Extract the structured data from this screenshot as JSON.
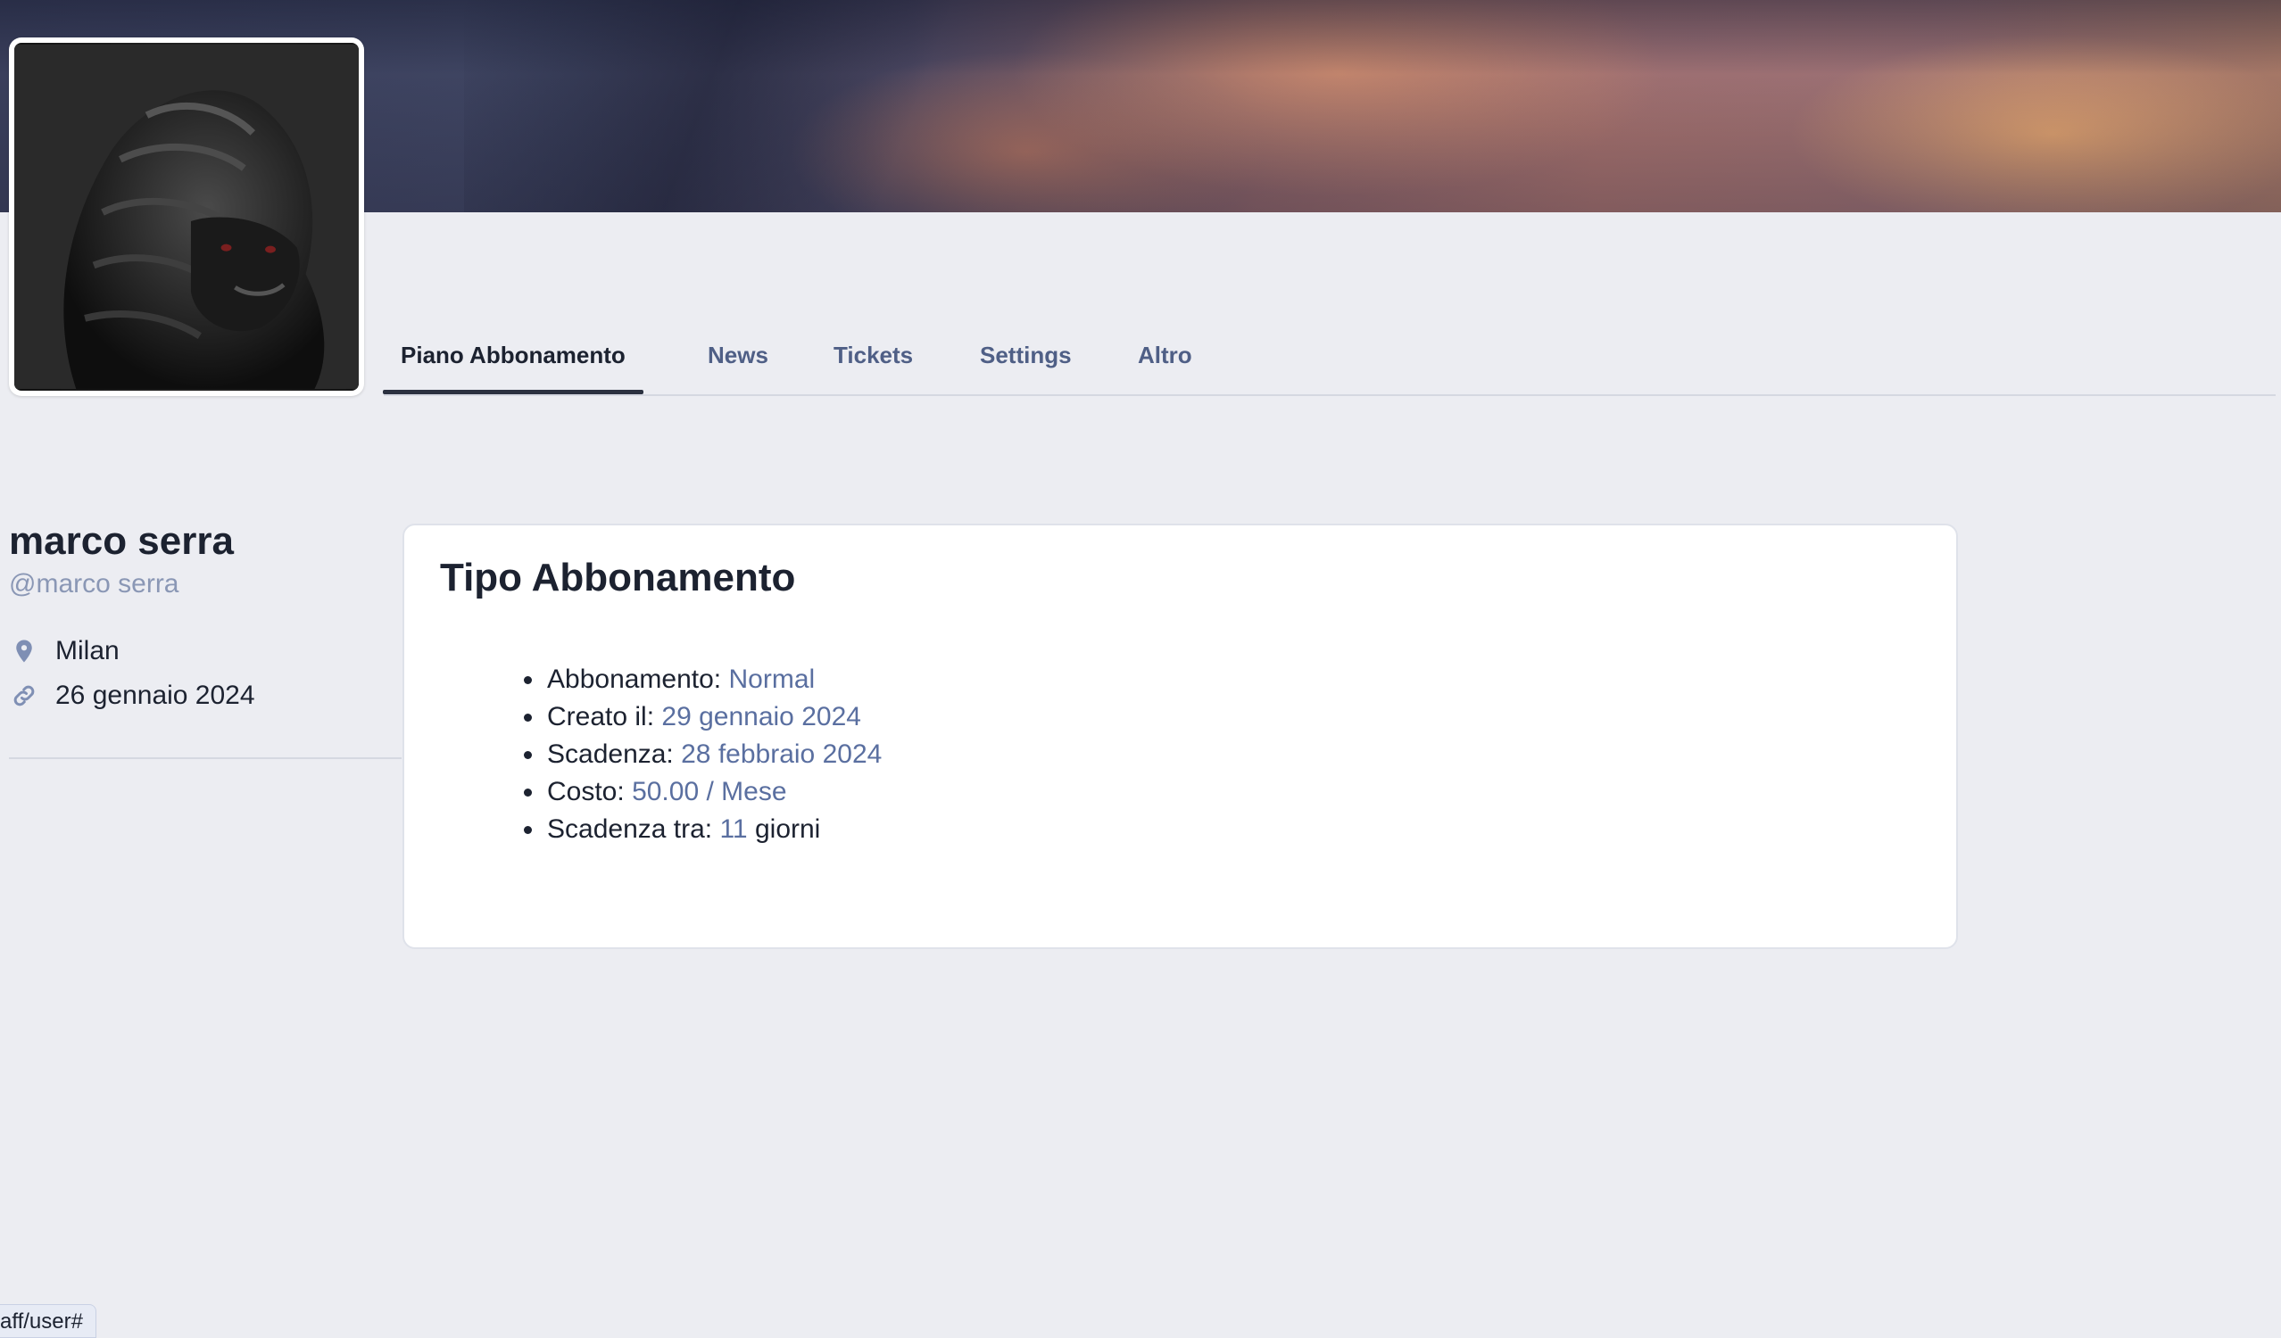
{
  "profile": {
    "name": "marco serra",
    "handle": "@marco serra",
    "location": "Milan",
    "joined": "26 gennaio 2024"
  },
  "tabs": [
    {
      "label": "Piano Abbonamento",
      "active": true
    },
    {
      "label": "News",
      "active": false
    },
    {
      "label": "Tickets",
      "active": false
    },
    {
      "label": "Settings",
      "active": false
    },
    {
      "label": "Altro",
      "active": false
    }
  ],
  "subscription": {
    "title": "Tipo Abbonamento",
    "items": [
      {
        "label": "Abbonamento:",
        "value": "Normal",
        "suffix": ""
      },
      {
        "label": "Creato il:",
        "value": "29 gennaio 2024",
        "suffix": ""
      },
      {
        "label": "Scadenza:",
        "value": "28 febbraio 2024",
        "suffix": ""
      },
      {
        "label": "Costo:",
        "value": "50.00 / Mese",
        "suffix": ""
      },
      {
        "label": "Scadenza tra:",
        "value": "11",
        "suffix": "giorni"
      }
    ]
  },
  "status_bar": {
    "link": "aff/user#"
  },
  "icons": {
    "location": "map-pin-icon",
    "joined": "link-icon"
  },
  "colors": {
    "accent_value": "#5a6fa0",
    "tab_inactive": "#4f5f86",
    "background": "#ecedf2"
  }
}
